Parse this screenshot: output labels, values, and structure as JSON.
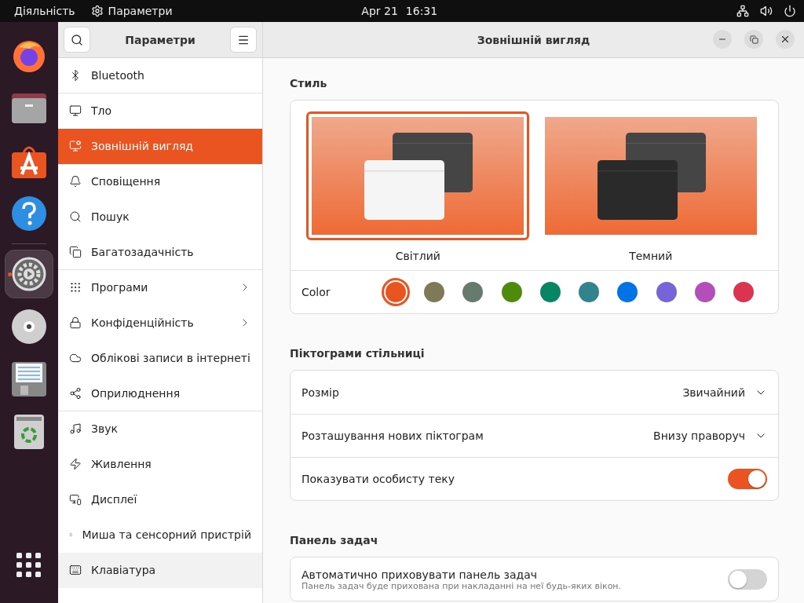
{
  "top_bar": {
    "activities": "Діяльність",
    "app_name": "Параметри",
    "date": "Apr 21",
    "time": "16:31"
  },
  "dock": [
    {
      "kind": "browser",
      "active": false
    },
    {
      "kind": "files",
      "active": false
    },
    {
      "kind": "store",
      "active": false
    },
    {
      "kind": "help",
      "active": false
    },
    {
      "kind": "separator",
      "active": false
    },
    {
      "kind": "settings",
      "active": true
    },
    {
      "kind": "disc",
      "active": false
    },
    {
      "kind": "floppy",
      "active": false
    },
    {
      "kind": "trash",
      "active": false
    },
    {
      "kind": "apps",
      "active": false
    }
  ],
  "sidebar": {
    "title": "Параметри",
    "items": [
      {
        "label": "Bluetooth",
        "selected": false,
        "hovered": false,
        "submenu": false,
        "divider_after": true
      },
      {
        "label": "Тло",
        "selected": false,
        "hovered": false,
        "submenu": false,
        "divider_after": false
      },
      {
        "label": "Зовнішній вигляд",
        "selected": true,
        "hovered": false,
        "submenu": false,
        "divider_after": false
      },
      {
        "label": "Сповіщення",
        "selected": false,
        "hovered": false,
        "submenu": false,
        "divider_after": false
      },
      {
        "label": "Пошук",
        "selected": false,
        "hovered": false,
        "submenu": false,
        "divider_after": false
      },
      {
        "label": "Багатозадачність",
        "selected": false,
        "hovered": false,
        "submenu": false,
        "divider_after": true
      },
      {
        "label": "Програми",
        "selected": false,
        "hovered": false,
        "submenu": true,
        "divider_after": false
      },
      {
        "label": "Конфіденційність",
        "selected": false,
        "hovered": false,
        "submenu": true,
        "divider_after": false
      },
      {
        "label": "Облікові записи в інтернеті",
        "selected": false,
        "hovered": false,
        "submenu": false,
        "divider_after": false
      },
      {
        "label": "Оприлюднення",
        "selected": false,
        "hovered": false,
        "submenu": false,
        "divider_after": true
      },
      {
        "label": "Звук",
        "selected": false,
        "hovered": false,
        "submenu": false,
        "divider_after": false
      },
      {
        "label": "Живлення",
        "selected": false,
        "hovered": false,
        "submenu": false,
        "divider_after": false
      },
      {
        "label": "Дисплеї",
        "selected": false,
        "hovered": false,
        "submenu": false,
        "divider_after": false
      },
      {
        "label": "Миша та сенсорний пристрій",
        "selected": false,
        "hovered": false,
        "submenu": false,
        "divider_after": false
      },
      {
        "label": "Клавіатура",
        "selected": false,
        "hovered": true,
        "submenu": false,
        "divider_after": false
      }
    ]
  },
  "window": {
    "title": "Зовнішній вигляд"
  },
  "style": {
    "heading": "Стиль",
    "themes": [
      {
        "label": "Світлий",
        "kind": "light",
        "selected": true
      },
      {
        "label": "Темний",
        "kind": "dark",
        "selected": false
      }
    ],
    "color_label": "Color",
    "colors": [
      {
        "color": "#e95420",
        "selected": true
      },
      {
        "color": "#7e7a58",
        "selected": false
      },
      {
        "color": "#667a6d",
        "selected": false
      },
      {
        "color": "#4e8a0b",
        "selected": false
      },
      {
        "color": "#088663",
        "selected": false
      },
      {
        "color": "#31848c",
        "selected": false
      },
      {
        "color": "#0073e5",
        "selected": false
      },
      {
        "color": "#7764d8",
        "selected": false
      },
      {
        "color": "#b44fb9",
        "selected": false
      },
      {
        "color": "#da3450",
        "selected": false
      }
    ]
  },
  "sections": [
    {
      "heading": "Піктограми стільниці",
      "rows": [
        {
          "kind": "dropdown",
          "label": "Розмір",
          "value": "Звичайний"
        },
        {
          "kind": "dropdown",
          "label": "Розташування нових піктограм",
          "value": "Внизу праворуч"
        },
        {
          "kind": "switch",
          "label": "Показувати особисту теку",
          "on": true
        }
      ]
    },
    {
      "heading": "Панель задач",
      "rows": [
        {
          "kind": "switch",
          "label": "Автоматично приховувати панель задач",
          "description": "Панель задач буде прихована при накладанні на неї будь-яких вікон.",
          "on": false
        }
      ]
    }
  ]
}
